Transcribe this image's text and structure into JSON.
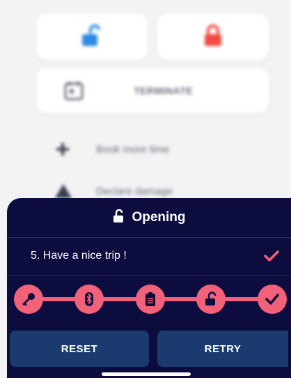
{
  "background": {
    "terminate_label": "TERMINATE",
    "book_more_time": "Book more time",
    "declare_damage": "Declare damage",
    "icons": {
      "unlock": "unlock-icon",
      "lock": "lock-icon",
      "calendar": "calendar-icon",
      "plus": "plus-icon",
      "warning": "warning-icon"
    }
  },
  "sheet": {
    "title": "Opening",
    "title_icon": "unlock-icon",
    "step_text": "5. Have a nice trip !",
    "step_status_icon": "check-icon",
    "progress_steps": [
      {
        "icon": "key-icon",
        "done": true
      },
      {
        "icon": "bluetooth-icon",
        "done": true
      },
      {
        "icon": "clipboard-icon",
        "done": true
      },
      {
        "icon": "unlock-icon",
        "done": true
      },
      {
        "icon": "check-icon",
        "done": true
      }
    ],
    "reset_label": "RESET",
    "retry_label": "RETRY"
  },
  "colors": {
    "sheet_bg": "#0d0c3e",
    "accent": "#f2617a",
    "button_bg": "#1a3a70",
    "unlock_blue": "#2d8ae6",
    "lock_red": "#f04b42"
  }
}
